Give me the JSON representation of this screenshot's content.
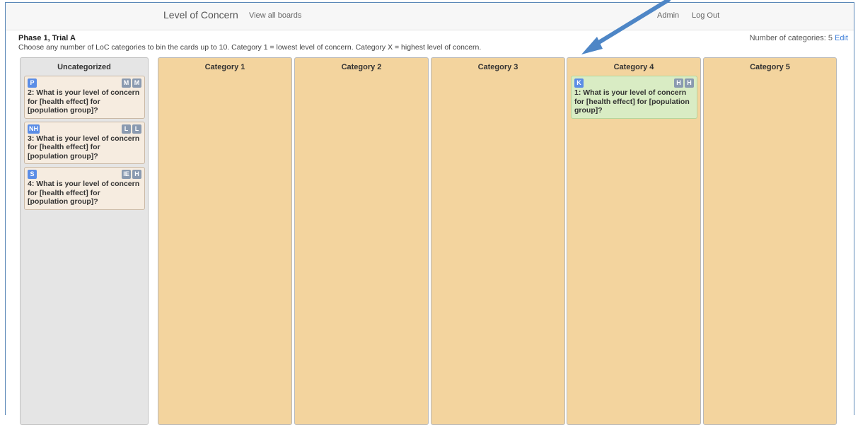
{
  "header": {
    "app_title": "Level of Concern",
    "view_all": "View all boards",
    "admin": "Admin",
    "logout": "Log Out"
  },
  "board": {
    "phase_title": "Phase 1, Trial A",
    "instructions": "Choose any number of LoC categories to bin the cards up to 10. Category 1 = lowest level of concern. Category X = highest level of concern.",
    "num_categories_label": "Number of categories: 5",
    "edit_label": "Edit"
  },
  "columns": [
    {
      "title": "Uncategorized",
      "cards": [
        {
          "id": "P",
          "tags": [
            "M",
            "M"
          ],
          "text": "2: What is your level of concern for [health effect] for [population group]?"
        },
        {
          "id": "NH",
          "tags": [
            "L",
            "L"
          ],
          "text": "3: What is your level of concern for [health effect] for [population group]?"
        },
        {
          "id": "S",
          "tags": [
            "IE",
            "H"
          ],
          "text": "4: What is your level of concern for [health effect] for [population group]?"
        }
      ]
    },
    {
      "title": "Category 1",
      "cards": []
    },
    {
      "title": "Category 2",
      "cards": []
    },
    {
      "title": "Category 3",
      "cards": []
    },
    {
      "title": "Category 4",
      "cards": [
        {
          "id": "K",
          "tags": [
            "H",
            "H"
          ],
          "text": "1: What is your level of concern for [health effect] for [population group]?"
        }
      ]
    },
    {
      "title": "Category 5",
      "cards": []
    }
  ],
  "colors": {
    "category_bg": "#f3d49e",
    "uncategorized_bg": "#e5e5e5",
    "card_bg": "#f6ece0",
    "card_highlight_bg": "#d9ecc4",
    "id_badge": "#5b8de6",
    "tag_badge": "#8a9ab0",
    "arrow": "#4e86c6"
  },
  "annotation": {
    "icon": "arrow-icon"
  }
}
